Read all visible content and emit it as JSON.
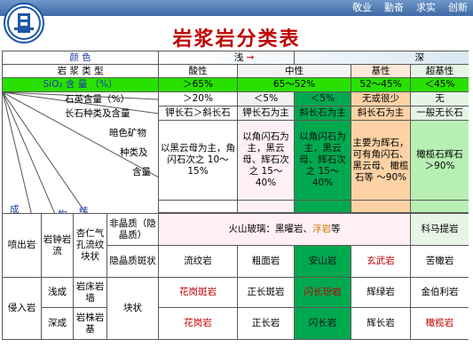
{
  "nav": [
    "敬业",
    "勤奋",
    "求实",
    "创新"
  ],
  "title": "岩浆岩分类表",
  "header": {
    "color_label": "颜 色",
    "shallow": "浅",
    "deep": "深",
    "type_label": "岩 浆 类 型",
    "types": [
      "酸性",
      "中性",
      "基性",
      "超基性"
    ],
    "sio2_label": "SiO₂ 含 量 （%）",
    "sio2": [
      "＞65%",
      "65～52%",
      "52～45%",
      "＜45%"
    ],
    "quartz_label": "石英含量（%）",
    "quartz": [
      "＞20%",
      "＜5%",
      "＜5%",
      "无或很少",
      "无"
    ],
    "feldspar_label": "长石种类及含量",
    "feldspar": [
      "钾长石＞斜长石",
      "钾长石为主",
      "斜长石为主",
      "斜长石为主",
      "一般无长石"
    ],
    "dark_label_1": "暗色矿物",
    "dark_label_2": "种类及",
    "dark_label_3": "含量",
    "dark": [
      "以黑云母为主，角闪石次之 10～15%",
      "以角闪石为主，黑云母、辉石次之 15～40%",
      "以角闪石为主，黑云母、辉石次之 15～40%",
      "主要为辉石，可有角闪石、黑云母、橄榄石等 ～90%",
      "橄榄石辉石 ＞90%"
    ],
    "axis_labels": [
      "成",
      "因",
      "类",
      "型",
      "产",
      "状",
      "构",
      "造",
      "结",
      "构"
    ]
  },
  "rows": {
    "extrusive": "喷出岩",
    "ex_forms": "岩钟岩流",
    "ex_struct": "杏仁气孔流纹块状",
    "ex_tex1": "非晶质（隐晶质）",
    "ex_tex2": "隐晶质斑状",
    "glass_prefix": "火山玻璃：黑曜岩、",
    "glass_red": "浮岩",
    "glass_suffix": "等",
    "komatiite": "科马提岩",
    "ex_rocks": [
      "流纹岩",
      "粗面岩",
      "安山岩",
      "玄武岩",
      "苦橄岩"
    ],
    "intrusive": "侵入岩",
    "shallow_label": "浅成",
    "shallow_forms": "岩床岩墙",
    "shallow_tex": "斑状全晶细粒",
    "shallow_rocks": [
      "花岗斑岩",
      "正长斑岩",
      "闪长玢岩",
      "辉绿岩",
      "金伯利岩"
    ],
    "in_struct": "块状",
    "deep_label": "深成",
    "deep_forms": "岩株岩基",
    "deep_tex": "结晶质状全晶中、粗粒",
    "deep_rocks": [
      "花岗岩",
      "正长岩",
      "闪长岩",
      "辉长岩",
      "橄榄岩"
    ]
  }
}
